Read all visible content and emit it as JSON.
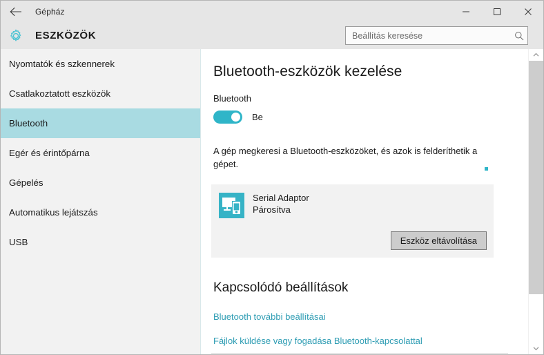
{
  "window": {
    "title": "Gépház",
    "back_label": "←",
    "minimize_label": "–",
    "maximize_label": "□",
    "close_label": "✕"
  },
  "header": {
    "app_title": "ESZKÖZÖK",
    "gear_icon": "gear-icon"
  },
  "search": {
    "placeholder": "Beállítás keresése",
    "value": "",
    "icon": "search-icon"
  },
  "sidebar": {
    "items": [
      {
        "label": "Nyomtatók és szkennerek",
        "selected": false
      },
      {
        "label": "Csatlakoztatott eszközök",
        "selected": false
      },
      {
        "label": "Bluetooth",
        "selected": true
      },
      {
        "label": "Egér és érintőpárna",
        "selected": false
      },
      {
        "label": "Gépelés",
        "selected": false
      },
      {
        "label": "Automatikus lejátszás",
        "selected": false
      },
      {
        "label": "USB",
        "selected": false
      }
    ]
  },
  "main": {
    "page_title": "Bluetooth-eszközök kezelése",
    "bluetooth_label": "Bluetooth",
    "toggle_state_label": "Be",
    "toggle_on": true,
    "description": "A gép megkeresi a Bluetooth-eszközöket, és azok is felderíthetik a gépet.",
    "device": {
      "name": "Serial Adaptor",
      "status": "Párosítva",
      "icon": "connected-devices-icon",
      "remove_button_label": "Eszköz eltávolítása"
    },
    "related": {
      "title": "Kapcsolódó beállítások",
      "links": [
        "Bluetooth további beállításai",
        "Fájlok küldése vagy fogadása Bluetooth-kapcsolattal"
      ]
    }
  },
  "colors": {
    "accent_teal": "#2fb5c8",
    "selection_teal": "#a9dbe2",
    "link_teal": "#2d9cb3",
    "chrome_gray": "#e6e6e6",
    "card_gray": "#f2f2f2",
    "button_gray": "#cccccc"
  }
}
